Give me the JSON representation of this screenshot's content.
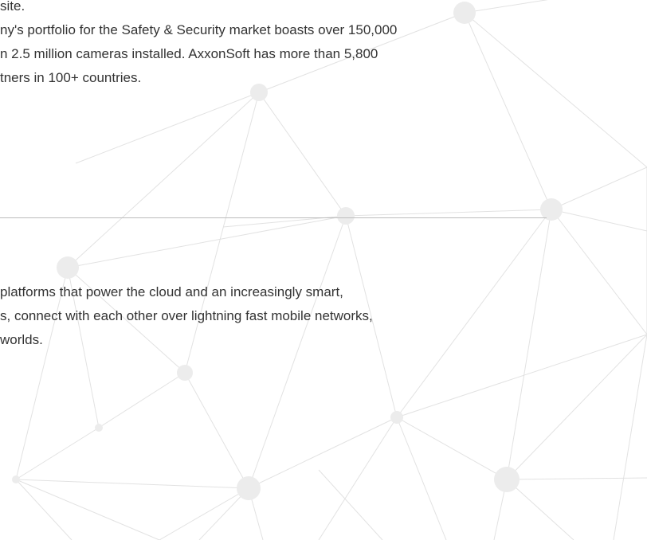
{
  "section_1": {
    "lines": [
      "site.",
      "ny's portfolio for the Safety & Security market boasts over 150,000",
      "n 2.5 million cameras installed. AxxonSoft has more than 5,800",
      "tners in 100+ countries."
    ]
  },
  "section_2": {
    "lines": [
      "platforms that power the cloud and an increasingly smart,",
      "s, connect with each other over lightning fast mobile networks,",
      "worlds."
    ]
  },
  "background": {
    "pattern": "network-nodes",
    "line_color": "#e2e2e2",
    "node_color": "#ececec"
  }
}
